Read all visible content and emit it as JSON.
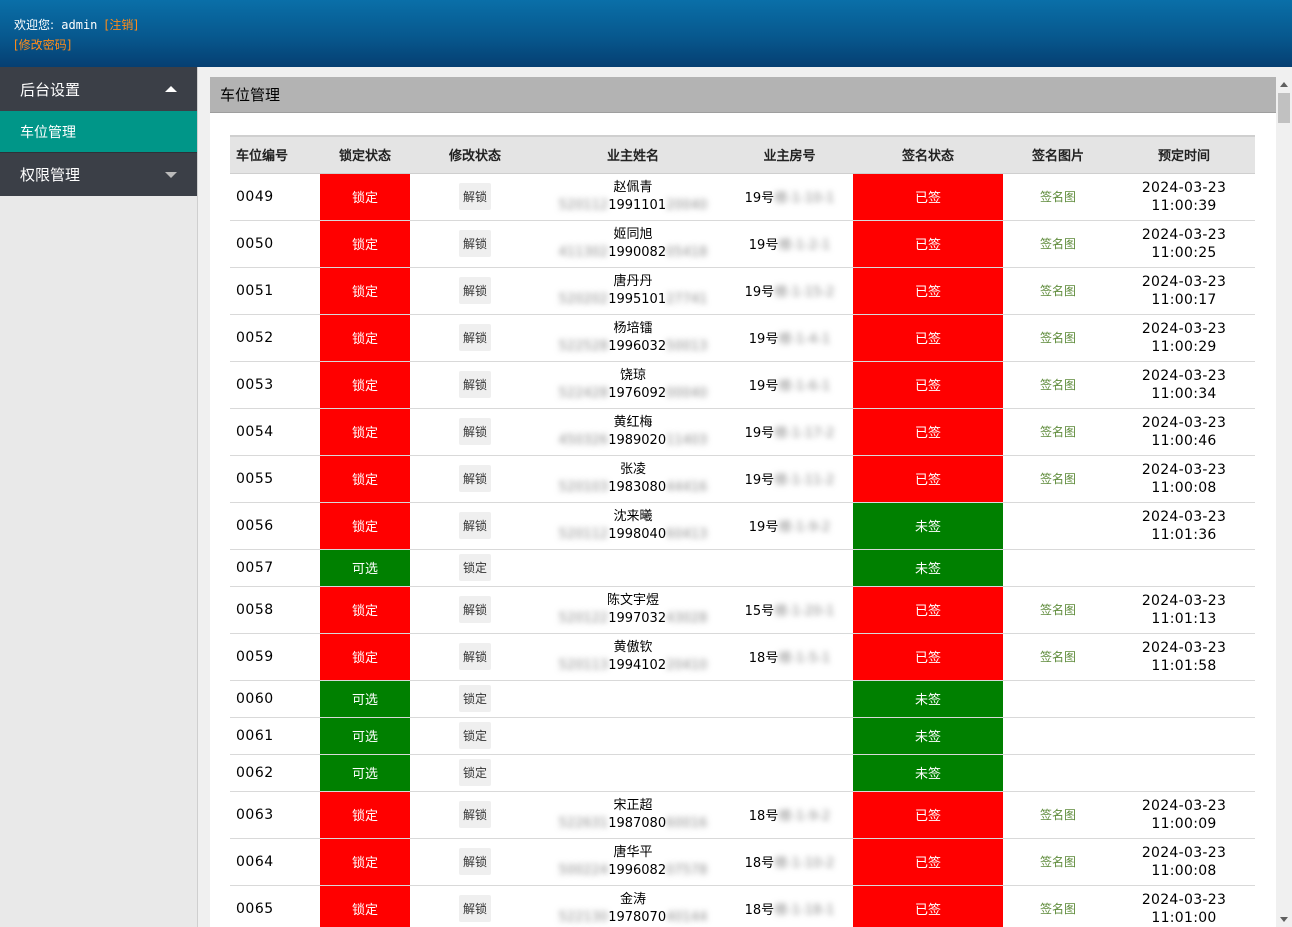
{
  "header": {
    "welcome": "欢迎您:",
    "user": "admin",
    "logout": "[注销]",
    "change_password": "[修改密码]"
  },
  "sidebar": {
    "groups": [
      {
        "label": "后台设置",
        "expanded": true,
        "items": [
          {
            "label": "车位管理",
            "active": true
          }
        ]
      },
      {
        "label": "权限管理",
        "expanded": false
      }
    ]
  },
  "panel": {
    "title": "车位管理"
  },
  "table": {
    "columns": [
      "车位编号",
      "锁定状态",
      "修改状态",
      "业主姓名",
      "业主房号",
      "签名状态",
      "签名图片",
      "预定时间"
    ],
    "rows": [
      {
        "no": "0049",
        "lock": "锁定",
        "action": "解锁",
        "name": "赵佩青",
        "id_visible": "1991101",
        "id_hidden_pre": "520112",
        "id_hidden_post": "20040",
        "room": "19号",
        "room_hidden": "楼-1-10-1",
        "sign": "已签",
        "pic": "签名图",
        "date": "2024-03-23",
        "time": "11:00:39"
      },
      {
        "no": "0050",
        "lock": "锁定",
        "action": "解锁",
        "name": "姬同旭",
        "id_visible": "1990082",
        "id_hidden_pre": "411302",
        "id_hidden_post": "05418",
        "room": "19号",
        "room_hidden": "楼-1-2-1",
        "sign": "已签",
        "pic": "签名图",
        "date": "2024-03-23",
        "time": "11:00:25"
      },
      {
        "no": "0051",
        "lock": "锁定",
        "action": "解锁",
        "name": "唐丹丹",
        "id_visible": "1995101",
        "id_hidden_pre": "520202",
        "id_hidden_post": "27741",
        "room": "19号",
        "room_hidden": "楼-1-15-2",
        "sign": "已签",
        "pic": "签名图",
        "date": "2024-03-23",
        "time": "11:00:17"
      },
      {
        "no": "0052",
        "lock": "锁定",
        "action": "解锁",
        "name": "杨培镭",
        "id_visible": "1996032",
        "id_hidden_pre": "522528",
        "id_hidden_post": "50013",
        "room": "19号",
        "room_hidden": "楼-1-4-1",
        "sign": "已签",
        "pic": "签名图",
        "date": "2024-03-23",
        "time": "11:00:29"
      },
      {
        "no": "0053",
        "lock": "锁定",
        "action": "解锁",
        "name": "饶琼",
        "id_visible": "1976092",
        "id_hidden_pre": "522428",
        "id_hidden_post": "00040",
        "room": "19号",
        "room_hidden": "楼-1-6-1",
        "sign": "已签",
        "pic": "签名图",
        "date": "2024-03-23",
        "time": "11:00:34"
      },
      {
        "no": "0054",
        "lock": "锁定",
        "action": "解锁",
        "name": "黄红梅",
        "id_visible": "1989020",
        "id_hidden_pre": "450326",
        "id_hidden_post": "11403",
        "room": "19号",
        "room_hidden": "楼-1-17-2",
        "sign": "已签",
        "pic": "签名图",
        "date": "2024-03-23",
        "time": "11:00:46"
      },
      {
        "no": "0055",
        "lock": "锁定",
        "action": "解锁",
        "name": "张凌",
        "id_visible": "1983080",
        "id_hidden_pre": "520103",
        "id_hidden_post": "44416",
        "room": "19号",
        "room_hidden": "楼-1-11-2",
        "sign": "已签",
        "pic": "签名图",
        "date": "2024-03-23",
        "time": "11:00:08"
      },
      {
        "no": "0056",
        "lock": "锁定",
        "action": "解锁",
        "name": "沈来曦",
        "id_visible": "1998040",
        "id_hidden_pre": "520112",
        "id_hidden_post": "60413",
        "room": "19号",
        "room_hidden": "楼-1-9-2",
        "sign": "未签",
        "pic": "",
        "date": "2024-03-23",
        "time": "11:01:36"
      },
      {
        "no": "0057",
        "lock": "可选",
        "action": "锁定",
        "name": "",
        "id_visible": "",
        "id_hidden_pre": "",
        "id_hidden_post": "",
        "room": "",
        "room_hidden": "",
        "sign": "未签",
        "pic": "",
        "date": "",
        "time": ""
      },
      {
        "no": "0058",
        "lock": "锁定",
        "action": "解锁",
        "name": "陈文宇煜",
        "id_visible": "1997032",
        "id_hidden_pre": "520122",
        "id_hidden_post": "43028",
        "room": "15号",
        "room_hidden": "楼-1-20-1",
        "sign": "已签",
        "pic": "签名图",
        "date": "2024-03-23",
        "time": "11:01:13"
      },
      {
        "no": "0059",
        "lock": "锁定",
        "action": "解锁",
        "name": "黄傲钦",
        "id_visible": "1994102",
        "id_hidden_pre": "520113",
        "id_hidden_post": "20410",
        "room": "18号",
        "room_hidden": "楼-1-5-1",
        "sign": "已签",
        "pic": "签名图",
        "date": "2024-03-23",
        "time": "11:01:58"
      },
      {
        "no": "0060",
        "lock": "可选",
        "action": "锁定",
        "name": "",
        "id_visible": "",
        "id_hidden_pre": "",
        "id_hidden_post": "",
        "room": "",
        "room_hidden": "",
        "sign": "未签",
        "pic": "",
        "date": "",
        "time": ""
      },
      {
        "no": "0061",
        "lock": "可选",
        "action": "锁定",
        "name": "",
        "id_visible": "",
        "id_hidden_pre": "",
        "id_hidden_post": "",
        "room": "",
        "room_hidden": "",
        "sign": "未签",
        "pic": "",
        "date": "",
        "time": ""
      },
      {
        "no": "0062",
        "lock": "可选",
        "action": "锁定",
        "name": "",
        "id_visible": "",
        "id_hidden_pre": "",
        "id_hidden_post": "",
        "room": "",
        "room_hidden": "",
        "sign": "未签",
        "pic": "",
        "date": "",
        "time": ""
      },
      {
        "no": "0063",
        "lock": "锁定",
        "action": "解锁",
        "name": "宋正超",
        "id_visible": "1987080",
        "id_hidden_pre": "522631",
        "id_hidden_post": "60016",
        "room": "18号",
        "room_hidden": "楼-1-9-2",
        "sign": "已签",
        "pic": "签名图",
        "date": "2024-03-23",
        "time": "11:00:09"
      },
      {
        "no": "0064",
        "lock": "锁定",
        "action": "解锁",
        "name": "唐华平",
        "id_visible": "1996082",
        "id_hidden_pre": "500224",
        "id_hidden_post": "07578",
        "room": "18号",
        "room_hidden": "楼-1-10-2",
        "sign": "已签",
        "pic": "签名图",
        "date": "2024-03-23",
        "time": "11:00:08"
      },
      {
        "no": "0065",
        "lock": "锁定",
        "action": "解锁",
        "name": "金涛",
        "id_visible": "1978070",
        "id_hidden_pre": "522130",
        "id_hidden_post": "40144",
        "room": "18号",
        "room_hidden": "楼-1-18-1",
        "sign": "已签",
        "pic": "签名图",
        "date": "2024-03-23",
        "time": "11:01:00"
      }
    ]
  },
  "colors": {
    "header_top": "#0a6fa8",
    "header_bottom": "#063f72",
    "accent_orange": "#ff8c1a",
    "menu_dark": "#3b3f47",
    "menu_active": "#009688",
    "locked_red": "#ff0000",
    "available_green": "#008000",
    "sign_link": "#5e8b3a"
  }
}
